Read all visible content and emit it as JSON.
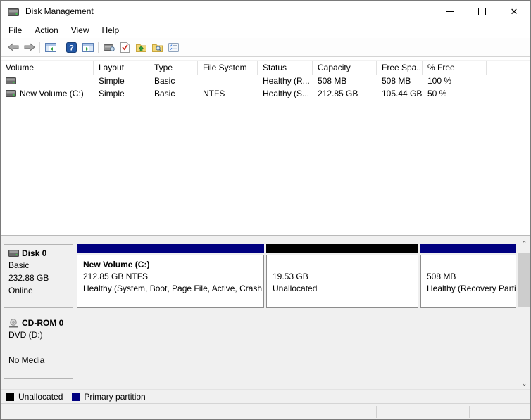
{
  "window": {
    "title": "Disk Management"
  },
  "menu": {
    "items": [
      "File",
      "Action",
      "View",
      "Help"
    ]
  },
  "toolbar": {
    "icons": [
      "back",
      "forward",
      "show-console-tree",
      "help",
      "show-action-pane",
      "device-view",
      "check-tasks",
      "folder-up",
      "folder-search",
      "properties-list"
    ]
  },
  "volume_table": {
    "columns": {
      "volume": "Volume",
      "layout": "Layout",
      "type": "Type",
      "file_system": "File System",
      "status": "Status",
      "capacity": "Capacity",
      "free_space": "Free Spa...",
      "percent_free": "% Free"
    },
    "rows": [
      {
        "volume": "",
        "layout": "Simple",
        "type": "Basic",
        "file_system": "",
        "status": "Healthy (R...",
        "capacity": "508 MB",
        "free_space": "508 MB",
        "percent_free": "100 %"
      },
      {
        "volume": "New Volume (C:)",
        "layout": "Simple",
        "type": "Basic",
        "file_system": "NTFS",
        "status": "Healthy (S...",
        "capacity": "212.85 GB",
        "free_space": "105.44 GB",
        "percent_free": "50 %"
      }
    ]
  },
  "disks": [
    {
      "name": "Disk 0",
      "type": "Basic",
      "size": "232.88 GB",
      "status": "Online",
      "partitions": [
        {
          "title": "New Volume  (C:)",
          "size_fs": "212.85 GB NTFS",
          "status": "Healthy (System, Boot, Page File, Active, Crash D",
          "color": "#000080"
        },
        {
          "title": "",
          "size_fs": "19.53 GB",
          "status": "Unallocated",
          "color": "#000000"
        },
        {
          "title": "",
          "size_fs": "508 MB",
          "status": "Healthy (Recovery Parti",
          "color": "#000080"
        }
      ]
    },
    {
      "name": "CD-ROM 0",
      "type": "DVD (D:)",
      "media": "No Media",
      "partitions": []
    }
  ],
  "legend": {
    "items": [
      {
        "label": "Unallocated",
        "color": "#000000"
      },
      {
        "label": "Primary partition",
        "color": "#000080"
      }
    ]
  }
}
